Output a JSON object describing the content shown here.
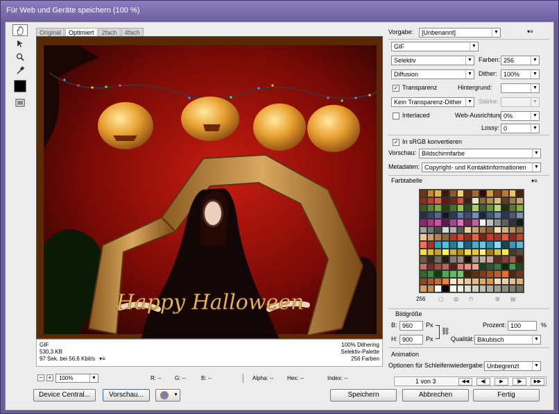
{
  "window": {
    "title": "Für Web und Geräte speichern (100 %)"
  },
  "tools": [
    "hand-icon",
    "slice-select-icon",
    "zoom-icon",
    "eyedropper-icon"
  ],
  "tabs": [
    {
      "label": "Original"
    },
    {
      "label": "Optimiert",
      "active": true
    },
    {
      "label": "2fach"
    },
    {
      "label": "4fach"
    }
  ],
  "image": {
    "caption": "Happy Halloween"
  },
  "info": {
    "format": "GIF",
    "size": "530,3 KB",
    "time": "97 Sek. bei 56,6 Kbit/s",
    "dithering": "100% Dithering",
    "palette": "Selektiv-Palette",
    "colors": "256 Farben"
  },
  "status": {
    "zoom": "100%",
    "r": "R: --",
    "g": "G: --",
    "b": "B: --",
    "alpha": "Alpha: --",
    "hex": "Hex: --",
    "index": "Index: --"
  },
  "buttons": {
    "device_central": "Device Central...",
    "preview": "Vorschau...",
    "save": "Speichern",
    "cancel": "Abbrechen",
    "done": "Fertig"
  },
  "settings": {
    "preset_label": "Vorgabe:",
    "preset_value": "[Unbenannt]",
    "format": "GIF",
    "reduction": "Selektiv",
    "colors_label": "Farben:",
    "colors_value": "256",
    "dither_algo": "Diffusion",
    "dither_label": "Dither:",
    "dither_value": "100%",
    "transparency_label": "Transparenz",
    "transparency_checked": true,
    "matte_label": "Hintergrund:",
    "matte_value": "",
    "trans_dither": "Kein Transparenz-Dither",
    "amount_label": "Stärke:",
    "amount_value": "",
    "interlaced_label": "Interlaced",
    "interlaced_checked": false,
    "websnap_label": "Web-Ausrichtung:",
    "websnap_value": "0%",
    "lossy_label": "Lossy:",
    "lossy_value": "0",
    "srgb_label": "In sRGB konvertieren",
    "srgb_checked": true,
    "preview_label": "Vorschau:",
    "preview_value": "Bildschirmfarbe",
    "metadata_label": "Metadaten:",
    "metadata_value": "Copyright- und Kontaktinformationen"
  },
  "color_table": {
    "title": "Farbtabelle",
    "count": "256",
    "colors": [
      "#6b3a12",
      "#c98a2e",
      "#e0b04c",
      "#3a1a08",
      "#8c5a22",
      "#f1d27a",
      "#5a2c10",
      "#a86a2a",
      "#2a0c04",
      "#d49a3c",
      "#7a4418",
      "#b87a34",
      "#edc060",
      "#4a220c",
      "#9a2a18",
      "#c2402a",
      "#e06040",
      "#601810",
      "#7a2212",
      "#d85030",
      "#402010",
      "#f0e8c0",
      "#8a6a3a",
      "#b09050",
      "#d8c080",
      "#5a4020",
      "#a07840",
      "#c8a868",
      "#3a5a20",
      "#5a8a30",
      "#7aaa40",
      "#2a4010",
      "#4a7028",
      "#90c050",
      "#304a18",
      "#a8d060",
      "#406030",
      "#689838",
      "#b8d878",
      "#203010",
      "#587a30",
      "#80b040",
      "#20304a",
      "#304870",
      "#4a6898",
      "#101828",
      "#283c5a",
      "#5a7aa8",
      "#384e78",
      "#7090c0",
      "#182438",
      "#405880",
      "#6888b0",
      "#283850",
      "#4a5a78",
      "#7a90b0",
      "#8a2a6a",
      "#b03a8a",
      "#d050a8",
      "#601848",
      "#a04890",
      "#e070c0",
      "#702858",
      "#c060a8",
      "#f0f0f0",
      "#c0c0c0",
      "#909090",
      "#606060",
      "#303030",
      "#181818",
      "#a0a0a0",
      "#787878",
      "#484848",
      "#d8d8d8",
      "#b0b0b0",
      "#585858",
      "#e8d0a0",
      "#c8a070",
      "#a87848",
      "#886030",
      "#f8e0b0",
      "#d8b080",
      "#b89060",
      "#987040",
      "#f0c890",
      "#d0a070",
      "#b08050",
      "#906838",
      "#c03020",
      "#e04830",
      "#a02818",
      "#f06040",
      "#802010",
      "#d03828",
      "#b03020",
      "#e85838",
      "#902818",
      "#c84028",
      "#f87050",
      "#a83020",
      "#30a0c0",
      "#50c0e0",
      "#2080a0",
      "#70d0f0",
      "#186080",
      "#40b0d0",
      "#60c8e8",
      "#2890b0",
      "#80e0f8",
      "#104858",
      "#3898b8",
      "#58b8d8",
      "#f0e040",
      "#e0c020",
      "#c8a818",
      "#f8f060",
      "#d0b028",
      "#b89010",
      "#f0d838",
      "#e8c830",
      "#fff080",
      "#a08010",
      "#d8c040",
      "#f8e850",
      "#4a3a2a",
      "#5a4a3a",
      "#6a5a4a",
      "#3a2a1a",
      "#7a6a5a",
      "#2a1a0a",
      "#8a7a6a",
      "#9a8a7a",
      "#1a0a00",
      "#aa9a8a",
      "#bab0a0",
      "#caa090",
      "#682818",
      "#884030",
      "#a85848",
      "#481808",
      "#c87060",
      "#783020",
      "#985040",
      "#b86858",
      "#582010",
      "#d88070",
      "#e89080",
      "#f0a090",
      "#1a3a1a",
      "#2a5a2a",
      "#3a7a3a",
      "#0a2a0a",
      "#4a9a4a",
      "#204820",
      "#306830",
      "#408840",
      "#104010",
      "#50a850",
      "#60b860",
      "#70c870",
      "#402008",
      "#603010",
      "#804018",
      "#a05020",
      "#c06028",
      "#e07030",
      "#502810",
      "#703818",
      "#904820",
      "#b05828",
      "#d06830",
      "#f08038",
      "#fce8c8",
      "#f8d8b0",
      "#f0c898",
      "#e8b880",
      "#e0a868",
      "#d89850",
      "#f4e0c0",
      "#ecd0a8",
      "#e4c090",
      "#dcb078",
      "#d4a060",
      "#cc9048",
      "#ffffff",
      "#000000",
      "#fffff0",
      "#f0f0e0",
      "#e0e0d0",
      "#d0d0c0",
      "#c0c0b0",
      "#b0b0a0",
      "#a0a090",
      "#909080",
      "#808070",
      "#707060"
    ]
  },
  "image_size": {
    "title": "Bildgröße",
    "w_label": "B:",
    "w_value": "960",
    "w_unit": "Px",
    "h_label": "H:",
    "h_value": "900",
    "h_unit": "Px",
    "percent_label": "Prozent:",
    "percent_value": "100",
    "percent_unit": "%",
    "quality_label": "Qualität:",
    "quality_value": "Bikubisch"
  },
  "animation": {
    "title": "Animation",
    "loop_label": "Optionen für Schleifenwiedergabe:",
    "loop_value": "Unbegrenzt",
    "frame": "1 von 3"
  }
}
